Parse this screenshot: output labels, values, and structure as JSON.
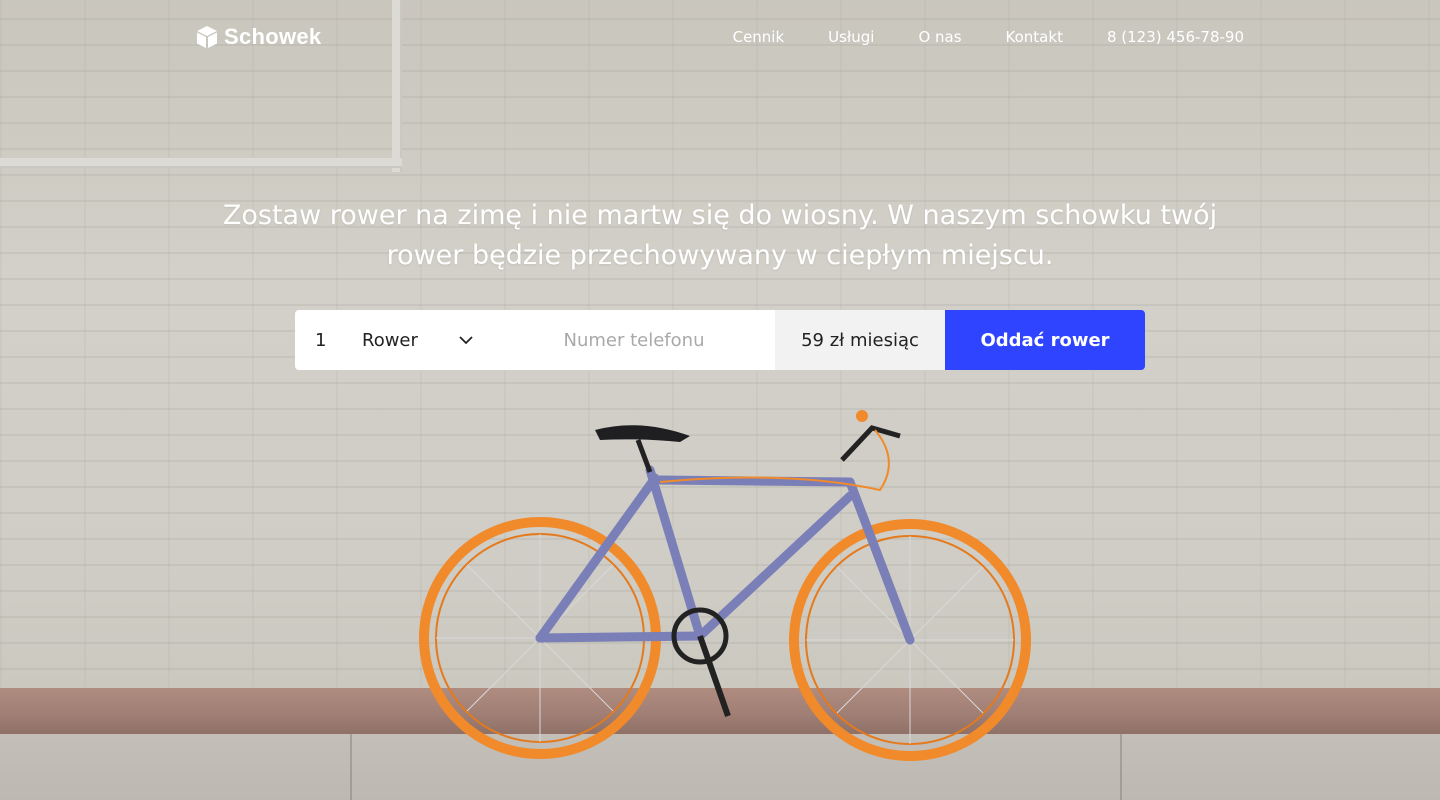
{
  "brand": {
    "name": "Schowek",
    "icon": "box-icon"
  },
  "nav": {
    "items": [
      {
        "label": "Cennik"
      },
      {
        "label": "Usługi"
      },
      {
        "label": "O nas"
      },
      {
        "label": "Kontakt"
      }
    ],
    "phone": "8 (123) 456-78-90"
  },
  "hero": {
    "headline": "Zostaw rower na zimę i nie martw się do wiosny. W naszym schowku twój rower będzie przechowywany w ciepłym miejscu."
  },
  "form": {
    "quantity": "1",
    "type": "Rower",
    "phone_placeholder": "Numer telefonu",
    "phone_value": "",
    "price": "59 zł miesiąc",
    "submit_label": "Oddać rower"
  },
  "colors": {
    "accent": "#2f44ff",
    "bike_wheels": "#f08a2a",
    "bike_frame": "#7a7fb8"
  }
}
